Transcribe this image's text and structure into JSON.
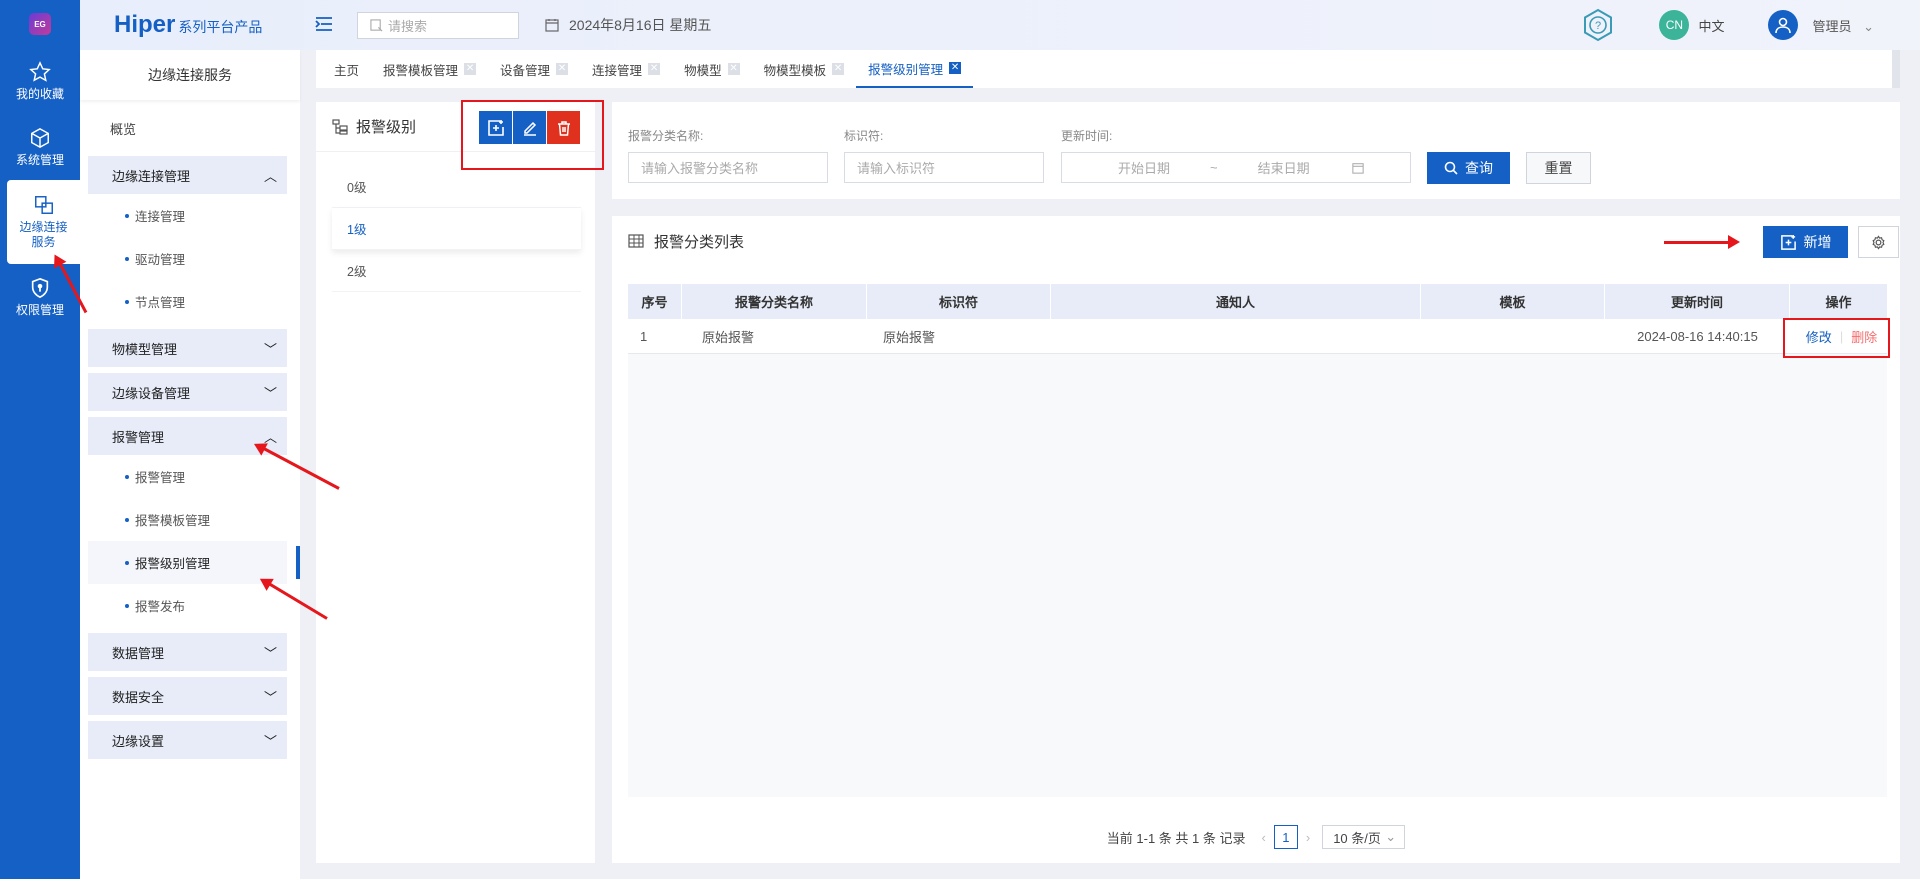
{
  "rail": {
    "items": [
      {
        "label": "我的收藏",
        "icon": "star-icon"
      },
      {
        "label": "系统管理",
        "icon": "cube-icon"
      },
      {
        "label": "边缘连接服务",
        "icon": "link-boxes-icon"
      },
      {
        "label": "权限管理",
        "icon": "shield-icon"
      }
    ],
    "logo_text": "EG"
  },
  "topbar": {
    "brand": "Hiper",
    "brand_sub": "系列平台产品",
    "search_placeholder": "请搜索",
    "date": "2024年8月16日 星期五",
    "lang_badge": "CN",
    "lang": "中文",
    "user": "管理员"
  },
  "sidebar": {
    "title": "边缘连接服务",
    "overview": "概览",
    "groups": {
      "edge_conn": "边缘连接管理",
      "model": "物模型管理",
      "edge_device": "边缘设备管理",
      "alarm": "报警管理",
      "data": "数据管理",
      "security": "数据安全",
      "settings": "边缘设置"
    },
    "edge_conn_items": [
      "连接管理",
      "驱动管理",
      "节点管理"
    ],
    "alarm_items": [
      "报警管理",
      "报警模板管理",
      "报警级别管理",
      "报警发布"
    ]
  },
  "tabs": [
    "主页",
    "报警模板管理",
    "设备管理",
    "连接管理",
    "物模型",
    "物模型模板",
    "报警级别管理"
  ],
  "level_panel": {
    "title": "报警级别",
    "levels": [
      "0级",
      "1级",
      "2级"
    ]
  },
  "filter": {
    "name_label": "报警分类名称:",
    "name_placeholder": "请输入报警分类名称",
    "id_label": "标识符:",
    "id_placeholder": "请输入标识符",
    "time_label": "更新时间:",
    "start_placeholder": "开始日期",
    "range_sep": "~",
    "end_placeholder": "结束日期",
    "query": "查询",
    "reset": "重置"
  },
  "table": {
    "title": "报警分类列表",
    "add": "新增",
    "columns": [
      "序号",
      "报警分类名称",
      "标识符",
      "通知人",
      "模板",
      "更新时间",
      "操作"
    ],
    "rows": [
      {
        "no": "1",
        "name": "原始报警",
        "id": "原始报警",
        "notify": "",
        "template": "",
        "time": "2024-08-16 14:40:15",
        "edit": "修改",
        "del": "删除"
      }
    ]
  },
  "pager": {
    "summary": "当前 1-1 条 共 1 条 记录",
    "page": "1",
    "size": "10 条/页"
  },
  "colors": {
    "primary": "#1560c4",
    "danger": "#e0301e",
    "annotation": "#e5161c"
  }
}
